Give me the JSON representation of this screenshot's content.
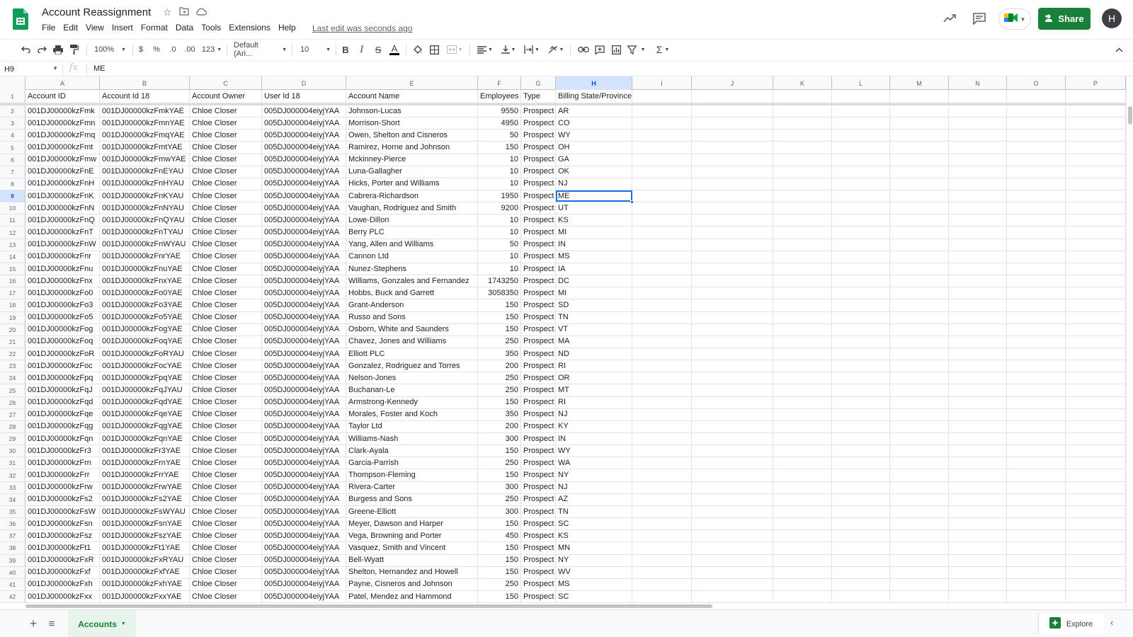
{
  "header": {
    "title": "Account Reassignment",
    "menus": [
      "File",
      "Edit",
      "View",
      "Insert",
      "Format",
      "Data",
      "Tools",
      "Extensions",
      "Help"
    ],
    "last_edit": "Last edit was seconds ago",
    "share_label": "Share",
    "avatar_initial": "H"
  },
  "toolbar": {
    "zoom": "100%",
    "currency": "$",
    "percent": "%",
    "decrease_decimal": ".0",
    "increase_decimal": ".00",
    "more_formats": "123",
    "font": "Default (Ari...",
    "font_size": "10"
  },
  "formula_bar": {
    "cell_ref": "H9",
    "fx": "fx",
    "value": "ME"
  },
  "columns": [
    "A",
    "B",
    "C",
    "D",
    "E",
    "F",
    "G",
    "H",
    "I",
    "J",
    "K",
    "L",
    "M",
    "N",
    "O",
    "P"
  ],
  "header_row": [
    "Account ID",
    "Account Id 18",
    "Account Owner",
    "User Id 18",
    "Account Name",
    "Employees",
    "Type",
    "Billing State/Province"
  ],
  "rows": [
    {
      "n": "2",
      "cells": [
        "001DJ00000kzFmk",
        "001DJ00000kzFmkYAE",
        "Chloe Closer",
        "005DJ000004eiyjYAA",
        "Johnson-Lucas",
        "9550",
        "Prospect",
        "AR"
      ]
    },
    {
      "n": "3",
      "cells": [
        "001DJ00000kzFmn",
        "001DJ00000kzFmnYAE",
        "Chloe Closer",
        "005DJ000004eiyjYAA",
        "Morrison-Short",
        "4950",
        "Prospect",
        "CO"
      ]
    },
    {
      "n": "4",
      "cells": [
        "001DJ00000kzFmq",
        "001DJ00000kzFmqYAE",
        "Chloe Closer",
        "005DJ000004eiyjYAA",
        "Owen, Shelton and Cisneros",
        "50",
        "Prospect",
        "WY"
      ]
    },
    {
      "n": "5",
      "cells": [
        "001DJ00000kzFmt",
        "001DJ00000kzFmtYAE",
        "Chloe Closer",
        "005DJ000004eiyjYAA",
        "Ramirez, Horne and Johnson",
        "150",
        "Prospect",
        "OH"
      ]
    },
    {
      "n": "6",
      "cells": [
        "001DJ00000kzFmw",
        "001DJ00000kzFmwYAE",
        "Chloe Closer",
        "005DJ000004eiyjYAA",
        "Mckinney-Pierce",
        "10",
        "Prospect",
        "GA"
      ]
    },
    {
      "n": "7",
      "cells": [
        "001DJ00000kzFnE",
        "001DJ00000kzFnEYAU",
        "Chloe Closer",
        "005DJ000004eiyjYAA",
        "Luna-Gallagher",
        "10",
        "Prospect",
        "OK"
      ]
    },
    {
      "n": "8",
      "cells": [
        "001DJ00000kzFnH",
        "001DJ00000kzFnHYAU",
        "Chloe Closer",
        "005DJ000004eiyjYAA",
        "Hicks, Porter and Williams",
        "10",
        "Prospect",
        "NJ"
      ]
    },
    {
      "n": "9",
      "cells": [
        "001DJ00000kzFnK",
        "001DJ00000kzFnKYAU",
        "Chloe Closer",
        "005DJ000004eiyjYAA",
        "Cabrera-Richardson",
        "1950",
        "Prospect",
        "ME"
      ]
    },
    {
      "n": "10",
      "cells": [
        "001DJ00000kzFnN",
        "001DJ00000kzFnNYAU",
        "Chloe Closer",
        "005DJ000004eiyjYAA",
        "Vaughan, Rodriguez and Smith",
        "9200",
        "Prospect",
        "UT"
      ]
    },
    {
      "n": "11",
      "cells": [
        "001DJ00000kzFnQ",
        "001DJ00000kzFnQYAU",
        "Chloe Closer",
        "005DJ000004eiyjYAA",
        "Lowe-Dillon",
        "10",
        "Prospect",
        "KS"
      ]
    },
    {
      "n": "12",
      "cells": [
        "001DJ00000kzFnT",
        "001DJ00000kzFnTYAU",
        "Chloe Closer",
        "005DJ000004eiyjYAA",
        "Berry PLC",
        "10",
        "Prospect",
        "MI"
      ]
    },
    {
      "n": "13",
      "cells": [
        "001DJ00000kzFnW",
        "001DJ00000kzFnWYAU",
        "Chloe Closer",
        "005DJ000004eiyjYAA",
        "Yang, Allen and Williams",
        "50",
        "Prospect",
        "IN"
      ]
    },
    {
      "n": "14",
      "cells": [
        "001DJ00000kzFnr",
        "001DJ00000kzFnrYAE",
        "Chloe Closer",
        "005DJ000004eiyjYAA",
        "Cannon Ltd",
        "10",
        "Prospect",
        "MS"
      ]
    },
    {
      "n": "15",
      "cells": [
        "001DJ00000kzFnu",
        "001DJ00000kzFnuYAE",
        "Chloe Closer",
        "005DJ000004eiyjYAA",
        "Nunez-Stephens",
        "10",
        "Prospect",
        "IA"
      ]
    },
    {
      "n": "16",
      "cells": [
        "001DJ00000kzFnx",
        "001DJ00000kzFnxYAE",
        "Chloe Closer",
        "005DJ000004eiyjYAA",
        "Williams, Gonzales and Fernandez",
        "1743250",
        "Prospect",
        "DC"
      ]
    },
    {
      "n": "17",
      "cells": [
        "001DJ00000kzFo0",
        "001DJ00000kzFo0YAE",
        "Chloe Closer",
        "005DJ000004eiyjYAA",
        "Hobbs, Buck and Garrett",
        "3058350",
        "Prospect",
        "MI"
      ]
    },
    {
      "n": "18",
      "cells": [
        "001DJ00000kzFo3",
        "001DJ00000kzFo3YAE",
        "Chloe Closer",
        "005DJ000004eiyjYAA",
        "Grant-Anderson",
        "150",
        "Prospect",
        "SD"
      ]
    },
    {
      "n": "19",
      "cells": [
        "001DJ00000kzFo5",
        "001DJ00000kzFo5YAE",
        "Chloe Closer",
        "005DJ000004eiyjYAA",
        "Russo and Sons",
        "150",
        "Prospect",
        "TN"
      ]
    },
    {
      "n": "20",
      "cells": [
        "001DJ00000kzFog",
        "001DJ00000kzFogYAE",
        "Chloe Closer",
        "005DJ000004eiyjYAA",
        "Osborn, White and Saunders",
        "150",
        "Prospect",
        "VT"
      ]
    },
    {
      "n": "21",
      "cells": [
        "001DJ00000kzFoq",
        "001DJ00000kzFoqYAE",
        "Chloe Closer",
        "005DJ000004eiyjYAA",
        "Chavez, Jones and Williams",
        "250",
        "Prospect",
        "MA"
      ]
    },
    {
      "n": "22",
      "cells": [
        "001DJ00000kzFoR",
        "001DJ00000kzFoRYAU",
        "Chloe Closer",
        "005DJ000004eiyjYAA",
        "Elliott PLC",
        "350",
        "Prospect",
        "ND"
      ]
    },
    {
      "n": "23",
      "cells": [
        "001DJ00000kzFoc",
        "001DJ00000kzFocYAE",
        "Chloe Closer",
        "005DJ000004eiyjYAA",
        "Gonzalez, Rodriguez and Torres",
        "200",
        "Prospect",
        "RI"
      ]
    },
    {
      "n": "24",
      "cells": [
        "001DJ00000kzFpq",
        "001DJ00000kzFpqYAE",
        "Chloe Closer",
        "005DJ000004eiyjYAA",
        "Nelson-Jones",
        "250",
        "Prospect",
        "OR"
      ]
    },
    {
      "n": "25",
      "cells": [
        "001DJ00000kzFqJ",
        "001DJ00000kzFqJYAU",
        "Chloe Closer",
        "005DJ000004eiyjYAA",
        "Buchanan-Le",
        "250",
        "Prospect",
        "MT"
      ]
    },
    {
      "n": "26",
      "cells": [
        "001DJ00000kzFqd",
        "001DJ00000kzFqdYAE",
        "Chloe Closer",
        "005DJ000004eiyjYAA",
        "Armstrong-Kennedy",
        "150",
        "Prospect",
        "RI"
      ]
    },
    {
      "n": "27",
      "cells": [
        "001DJ00000kzFqe",
        "001DJ00000kzFqeYAE",
        "Chloe Closer",
        "005DJ000004eiyjYAA",
        "Morales, Foster and Koch",
        "350",
        "Prospect",
        "NJ"
      ]
    },
    {
      "n": "28",
      "cells": [
        "001DJ00000kzFqg",
        "001DJ00000kzFqgYAE",
        "Chloe Closer",
        "005DJ000004eiyjYAA",
        "Taylor Ltd",
        "200",
        "Prospect",
        "KY"
      ]
    },
    {
      "n": "29",
      "cells": [
        "001DJ00000kzFqn",
        "001DJ00000kzFqnYAE",
        "Chloe Closer",
        "005DJ000004eiyjYAA",
        "Williams-Nash",
        "300",
        "Prospect",
        "IN"
      ]
    },
    {
      "n": "30",
      "cells": [
        "001DJ00000kzFr3",
        "001DJ00000kzFr3YAE",
        "Chloe Closer",
        "005DJ000004eiyjYAA",
        "Clark-Ayala",
        "150",
        "Prospect",
        "WY"
      ]
    },
    {
      "n": "31",
      "cells": [
        "001DJ00000kzFrn",
        "001DJ00000kzFrnYAE",
        "Chloe Closer",
        "005DJ000004eiyjYAA",
        "Garcia-Parrish",
        "250",
        "Prospect",
        "WA"
      ]
    },
    {
      "n": "32",
      "cells": [
        "001DJ00000kzFrr",
        "001DJ00000kzFrrYAE",
        "Chloe Closer",
        "005DJ000004eiyjYAA",
        "Thompson-Fleming",
        "150",
        "Prospect",
        "NY"
      ]
    },
    {
      "n": "33",
      "cells": [
        "001DJ00000kzFrw",
        "001DJ00000kzFrwYAE",
        "Chloe Closer",
        "005DJ000004eiyjYAA",
        "Rivera-Carter",
        "300",
        "Prospect",
        "NJ"
      ]
    },
    {
      "n": "34",
      "cells": [
        "001DJ00000kzFs2",
        "001DJ00000kzFs2YAE",
        "Chloe Closer",
        "005DJ000004eiyjYAA",
        "Burgess and Sons",
        "250",
        "Prospect",
        "AZ"
      ]
    },
    {
      "n": "35",
      "cells": [
        "001DJ00000kzFsW",
        "001DJ00000kzFsWYAU",
        "Chloe Closer",
        "005DJ000004eiyjYAA",
        "Greene-Elliott",
        "300",
        "Prospect",
        "TN"
      ]
    },
    {
      "n": "36",
      "cells": [
        "001DJ00000kzFsn",
        "001DJ00000kzFsnYAE",
        "Chloe Closer",
        "005DJ000004eiyjYAA",
        "Meyer, Dawson and Harper",
        "150",
        "Prospect",
        "SC"
      ]
    },
    {
      "n": "37",
      "cells": [
        "001DJ00000kzFsz",
        "001DJ00000kzFszYAE",
        "Chloe Closer",
        "005DJ000004eiyjYAA",
        "Vega, Browning and Porter",
        "450",
        "Prospect",
        "KS"
      ]
    },
    {
      "n": "38",
      "cells": [
        "001DJ00000kzFt1",
        "001DJ00000kzFt1YAE",
        "Chloe Closer",
        "005DJ000004eiyjYAA",
        "Vasquez, Smith and Vincent",
        "150",
        "Prospect",
        "MN"
      ]
    },
    {
      "n": "39",
      "cells": [
        "001DJ00000kzFxR",
        "001DJ00000kzFxRYAU",
        "Chloe Closer",
        "005DJ000004eiyjYAA",
        "Bell-Wyatt",
        "150",
        "Prospect",
        "NY"
      ]
    },
    {
      "n": "40",
      "cells": [
        "001DJ00000kzFxf",
        "001DJ00000kzFxfYAE",
        "Chloe Closer",
        "005DJ000004eiyjYAA",
        "Shelton, Hernandez and Howell",
        "150",
        "Prospect",
        "WV"
      ]
    },
    {
      "n": "41",
      "cells": [
        "001DJ00000kzFxh",
        "001DJ00000kzFxhYAE",
        "Chloe Closer",
        "005DJ000004eiyjYAA",
        "Payne, Cisneros and Johnson",
        "250",
        "Prospect",
        "MS"
      ]
    },
    {
      "n": "42",
      "cells": [
        "001DJ00000kzFxx",
        "001DJ00000kzFxxYAE",
        "Chloe Closer",
        "005DJ000004eiyjYAA",
        "Patel, Mendez and Hammond",
        "150",
        "Prospect",
        "SC"
      ]
    }
  ],
  "selection": {
    "column": "H",
    "row": "9"
  },
  "footer": {
    "sheet_tab": "Accounts",
    "explore_label": "Explore"
  },
  "colors": {
    "accent": "#1a73e8",
    "share_green": "#188038",
    "sheets_logo": "#0f9d58"
  }
}
